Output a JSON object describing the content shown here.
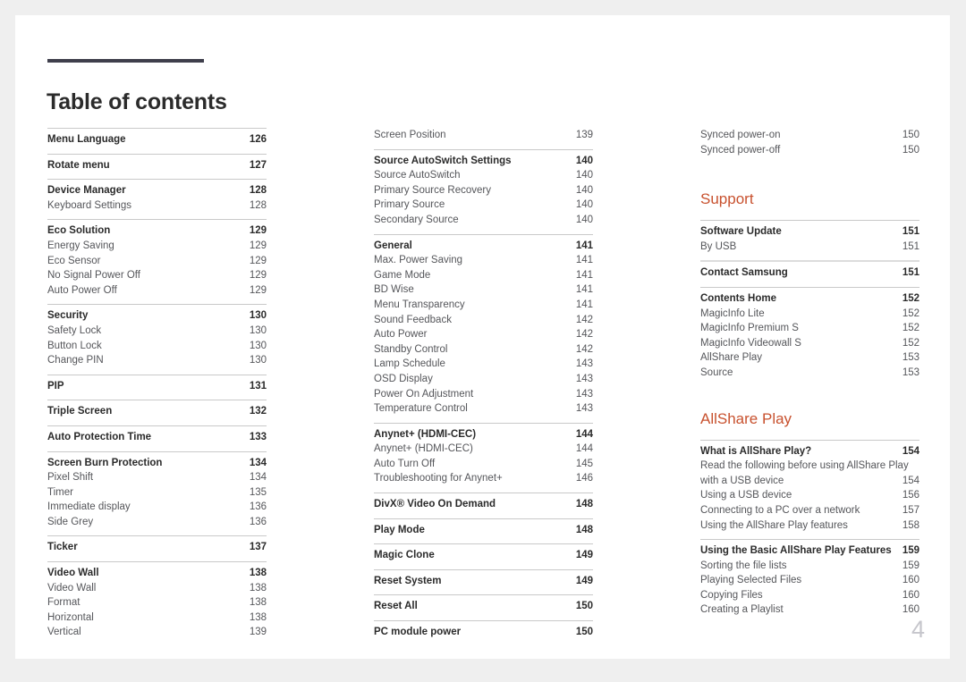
{
  "document": {
    "title": "Table of contents",
    "folio": "4",
    "accent_color": "#c8512e",
    "rule_color": "#3f3f4c"
  },
  "columns": [
    {
      "name": "column-1",
      "groups": [
        {
          "rule": "thin",
          "entries": [
            {
              "label": "Menu Language",
              "page": "126",
              "level": "head"
            }
          ]
        },
        {
          "rule": "thin",
          "entries": [
            {
              "label": "Rotate menu",
              "page": "127",
              "level": "head"
            }
          ]
        },
        {
          "rule": "thin",
          "entries": [
            {
              "label": "Device Manager",
              "page": "128",
              "level": "head"
            },
            {
              "label": "Keyboard Settings",
              "page": "128",
              "level": "sub"
            }
          ]
        },
        {
          "rule": "thin",
          "entries": [
            {
              "label": "Eco Solution",
              "page": "129",
              "level": "head"
            },
            {
              "label": "Energy Saving",
              "page": "129",
              "level": "sub"
            },
            {
              "label": "Eco Sensor",
              "page": "129",
              "level": "sub"
            },
            {
              "label": "No Signal Power Off",
              "page": "129",
              "level": "sub"
            },
            {
              "label": "Auto Power Off",
              "page": "129",
              "level": "sub"
            }
          ]
        },
        {
          "rule": "thin",
          "entries": [
            {
              "label": "Security",
              "page": "130",
              "level": "head"
            },
            {
              "label": "Safety Lock",
              "page": "130",
              "level": "sub"
            },
            {
              "label": "Button Lock",
              "page": "130",
              "level": "sub"
            },
            {
              "label": "Change PIN",
              "page": "130",
              "level": "sub"
            }
          ]
        },
        {
          "rule": "thin",
          "entries": [
            {
              "label": "PIP",
              "page": "131",
              "level": "head"
            }
          ]
        },
        {
          "rule": "thin",
          "entries": [
            {
              "label": "Triple Screen",
              "page": "132",
              "level": "head"
            }
          ]
        },
        {
          "rule": "thin",
          "entries": [
            {
              "label": "Auto Protection Time",
              "page": "133",
              "level": "head"
            }
          ]
        },
        {
          "rule": "thin",
          "entries": [
            {
              "label": "Screen Burn Protection",
              "page": "134",
              "level": "head"
            },
            {
              "label": "Pixel Shift",
              "page": "134",
              "level": "sub"
            },
            {
              "label": "Timer",
              "page": "135",
              "level": "sub"
            },
            {
              "label": "Immediate display",
              "page": "136",
              "level": "sub"
            },
            {
              "label": "Side Grey",
              "page": "136",
              "level": "sub"
            }
          ]
        },
        {
          "rule": "thin",
          "entries": [
            {
              "label": "Ticker",
              "page": "137",
              "level": "head"
            }
          ]
        },
        {
          "rule": "thin",
          "entries": [
            {
              "label": "Video Wall",
              "page": "138",
              "level": "head"
            },
            {
              "label": "Video Wall",
              "page": "138",
              "level": "sub"
            },
            {
              "label": "Format",
              "page": "138",
              "level": "sub"
            },
            {
              "label": "Horizontal",
              "page": "138",
              "level": "sub"
            },
            {
              "label": "Vertical",
              "page": "139",
              "level": "sub"
            }
          ]
        }
      ]
    },
    {
      "name": "column-2",
      "groups": [
        {
          "rule": "none",
          "entries": [
            {
              "label": "Screen Position",
              "page": "139",
              "level": "sub"
            }
          ]
        },
        {
          "rule": "thin",
          "entries": [
            {
              "label": "Source AutoSwitch Settings",
              "page": "140",
              "level": "head"
            },
            {
              "label": "Source AutoSwitch",
              "page": "140",
              "level": "sub"
            },
            {
              "label": "Primary Source Recovery",
              "page": "140",
              "level": "sub"
            },
            {
              "label": "Primary Source",
              "page": "140",
              "level": "sub"
            },
            {
              "label": "Secondary Source",
              "page": "140",
              "level": "sub"
            }
          ]
        },
        {
          "rule": "thin",
          "entries": [
            {
              "label": "General",
              "page": "141",
              "level": "head"
            },
            {
              "label": "Max. Power Saving",
              "page": "141",
              "level": "sub"
            },
            {
              "label": "Game Mode",
              "page": "141",
              "level": "sub"
            },
            {
              "label": "BD Wise",
              "page": "141",
              "level": "sub"
            },
            {
              "label": "Menu Transparency",
              "page": "141",
              "level": "sub"
            },
            {
              "label": "Sound Feedback",
              "page": "142",
              "level": "sub"
            },
            {
              "label": "Auto Power",
              "page": "142",
              "level": "sub"
            },
            {
              "label": "Standby Control",
              "page": "142",
              "level": "sub"
            },
            {
              "label": "Lamp Schedule",
              "page": "143",
              "level": "sub"
            },
            {
              "label": "OSD Display",
              "page": "143",
              "level": "sub"
            },
            {
              "label": "Power On Adjustment",
              "page": "143",
              "level": "sub"
            },
            {
              "label": "Temperature Control",
              "page": "143",
              "level": "sub"
            }
          ]
        },
        {
          "rule": "thin",
          "entries": [
            {
              "label": "Anynet+ (HDMI-CEC)",
              "page": "144",
              "level": "head"
            },
            {
              "label": "Anynet+ (HDMI-CEC)",
              "page": "144",
              "level": "sub"
            },
            {
              "label": "Auto Turn Off",
              "page": "145",
              "level": "sub"
            },
            {
              "label": "Troubleshooting for Anynet+",
              "page": "146",
              "level": "sub"
            }
          ]
        },
        {
          "rule": "thin",
          "entries": [
            {
              "label": "DivX® Video On Demand",
              "page": "148",
              "level": "head"
            }
          ]
        },
        {
          "rule": "thin",
          "entries": [
            {
              "label": "Play Mode",
              "page": "148",
              "level": "head"
            }
          ]
        },
        {
          "rule": "thin",
          "entries": [
            {
              "label": "Magic Clone",
              "page": "149",
              "level": "head"
            }
          ]
        },
        {
          "rule": "thin",
          "entries": [
            {
              "label": "Reset System",
              "page": "149",
              "level": "head"
            }
          ]
        },
        {
          "rule": "thin",
          "entries": [
            {
              "label": "Reset All",
              "page": "150",
              "level": "head"
            }
          ]
        },
        {
          "rule": "thin",
          "entries": [
            {
              "label": "PC module power",
              "page": "150",
              "level": "head"
            }
          ]
        }
      ]
    },
    {
      "name": "column-3",
      "groups": [
        {
          "rule": "none",
          "entries": [
            {
              "label": "Synced power-on",
              "page": "150",
              "level": "sub"
            },
            {
              "label": "Synced power-off",
              "page": "150",
              "level": "sub"
            }
          ]
        }
      ],
      "sections": [
        {
          "title": "Support",
          "groups": [
            {
              "rule": "thin",
              "entries": [
                {
                  "label": "Software Update",
                  "page": "151",
                  "level": "head"
                },
                {
                  "label": "By USB",
                  "page": "151",
                  "level": "sub"
                }
              ]
            },
            {
              "rule": "thick",
              "entries": [
                {
                  "label": "Contact Samsung",
                  "page": "151",
                  "level": "head"
                }
              ]
            },
            {
              "rule": "thin",
              "entries": [
                {
                  "label": "Contents Home",
                  "page": "152",
                  "level": "head"
                },
                {
                  "label": "MagicInfo Lite",
                  "page": "152",
                  "level": "sub"
                },
                {
                  "label": "MagicInfo Premium S",
                  "page": "152",
                  "level": "sub"
                },
                {
                  "label": "MagicInfo Videowall S",
                  "page": "152",
                  "level": "sub"
                },
                {
                  "label": "AllShare Play",
                  "page": "153",
                  "level": "sub"
                },
                {
                  "label": "Source",
                  "page": "153",
                  "level": "sub"
                }
              ]
            }
          ]
        },
        {
          "title": "AllShare Play",
          "groups": [
            {
              "rule": "thin",
              "entries": [
                {
                  "label": "What is AllShare Play?",
                  "page": "154",
                  "level": "head"
                },
                {
                  "label": "Read the following before using AllShare Play",
                  "label2": "with a USB device",
                  "page": "154",
                  "level": "sub-wrap"
                },
                {
                  "label": "Using a USB device",
                  "page": "156",
                  "level": "sub"
                },
                {
                  "label": "Connecting to a PC over a network",
                  "page": "157",
                  "level": "sub"
                },
                {
                  "label": "Using the AllShare Play features",
                  "page": "158",
                  "level": "sub"
                }
              ]
            },
            {
              "rule": "thin",
              "entries": [
                {
                  "label": "Using the Basic AllShare Play Features",
                  "page": "159",
                  "level": "head"
                },
                {
                  "label": "Sorting the file lists",
                  "page": "159",
                  "level": "sub"
                },
                {
                  "label": "Playing Selected Files",
                  "page": "160",
                  "level": "sub"
                },
                {
                  "label": "Copying Files",
                  "page": "160",
                  "level": "sub"
                },
                {
                  "label": "Creating a Playlist",
                  "page": "160",
                  "level": "sub"
                }
              ]
            }
          ]
        }
      ]
    }
  ]
}
